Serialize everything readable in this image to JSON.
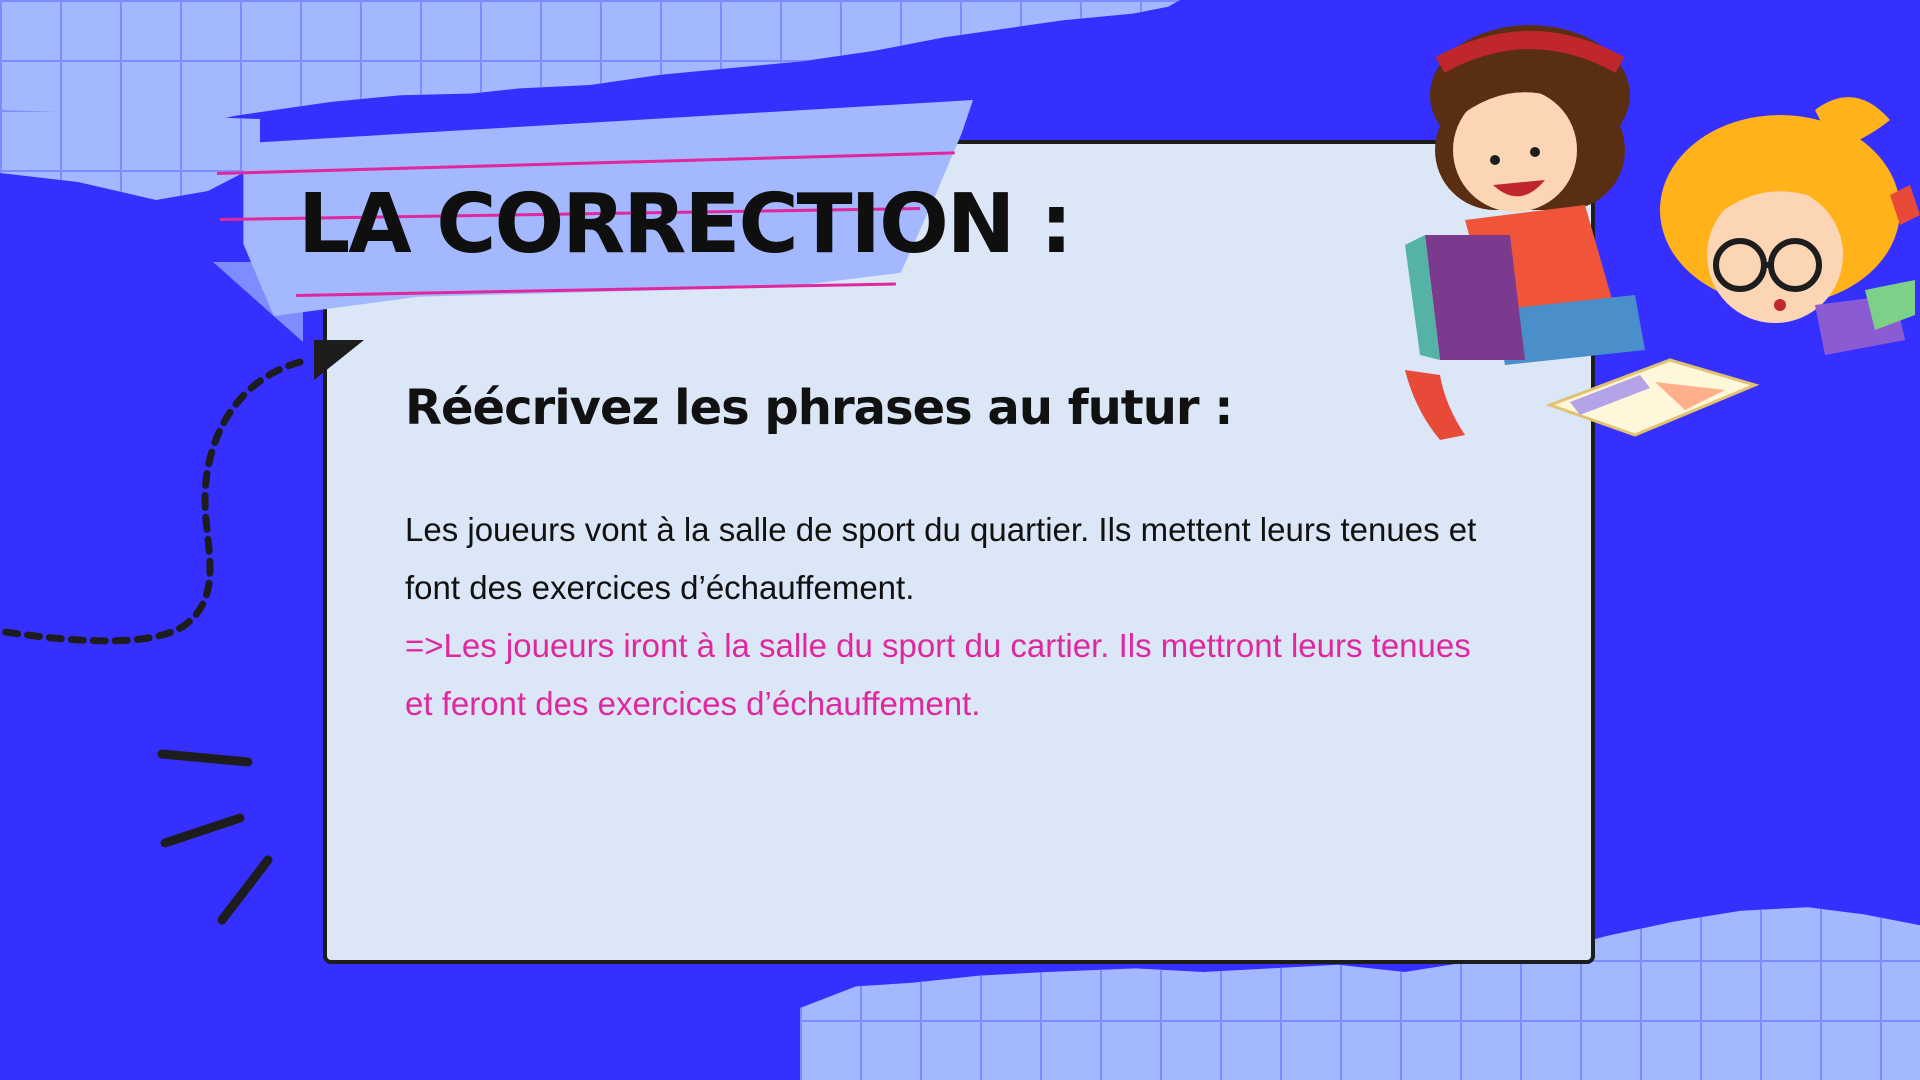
{
  "slide": {
    "title": "LA CORRECTION :",
    "subtitle": "Réécrivez les phrases au futur :",
    "exercise_text": "Les joueurs vont à la salle de sport du quartier. Ils mettent leurs tenues et font des exercices d’échauffement.",
    "answer_text": "=>Les joueurs iront à la salle du sport du cartier. Ils mettront leurs tenues et feront des exercices d’échauffement."
  },
  "colors": {
    "background": "#3530ff",
    "grid_paper": "#a3b8ff",
    "card": "#dbe6f6",
    "answer_text": "#e0289e",
    "tape_line": "#e0289e"
  },
  "icons": [
    "dotted-curve-decoration",
    "brush-strokes-decoration",
    "children-reading-illustration"
  ]
}
